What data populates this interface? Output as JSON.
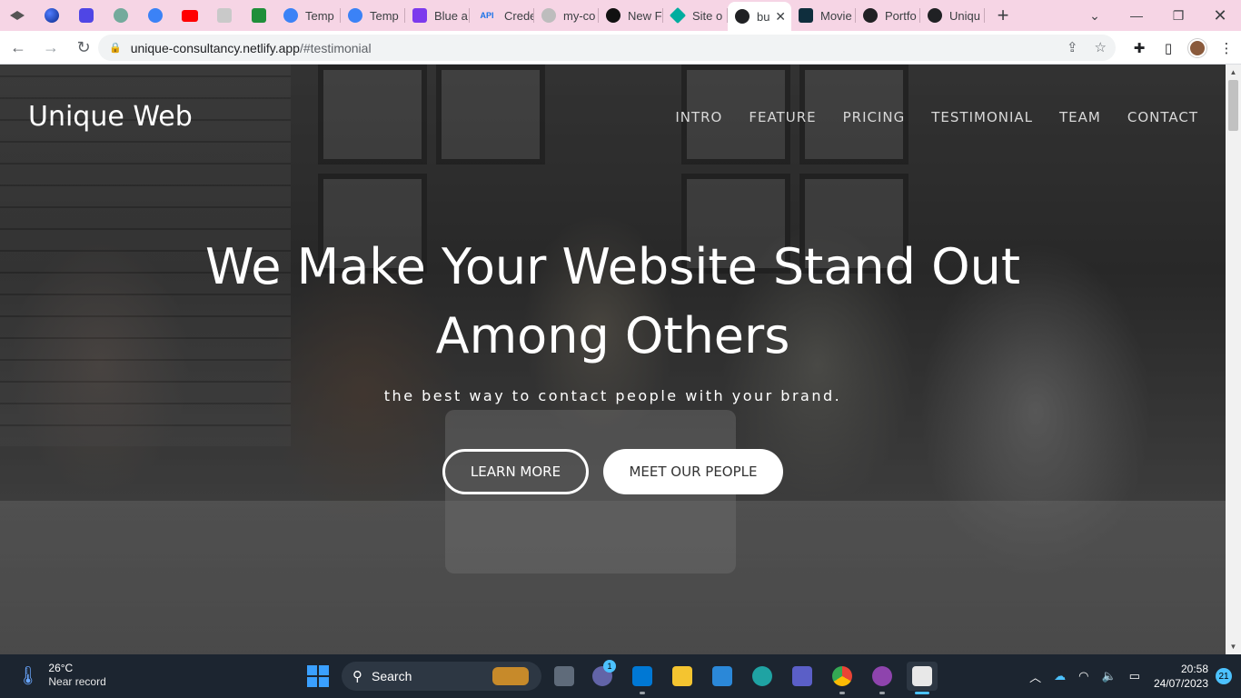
{
  "browser": {
    "tabs": [
      {
        "title": "Temp",
        "color": "#3b82f6",
        "icon": "edge-style-icon"
      },
      {
        "title": "Temp",
        "color": "#3b82f6",
        "icon": "edge-style-icon"
      },
      {
        "title": "Blue a",
        "color": "#7c3aed",
        "icon": "heart-shield-icon"
      },
      {
        "title": "Crede",
        "color": "#1a73e8",
        "icon": "api-icon"
      },
      {
        "title": "my-co",
        "color": "#bdbdbd",
        "icon": "github-icon"
      },
      {
        "title": "New F",
        "color": "#111111",
        "icon": "triangle-icon"
      },
      {
        "title": "Site o",
        "color": "#00ad9f",
        "icon": "netlify-icon"
      },
      {
        "title": "bu",
        "color": "#202124",
        "icon": "globe-icon",
        "active": true
      },
      {
        "title": "Movie",
        "color": "#0f2e3d",
        "icon": "react-icon"
      },
      {
        "title": "Portfo",
        "color": "#202124",
        "icon": "globe-icon"
      },
      {
        "title": "Uniqu",
        "color": "#202124",
        "icon": "globe-icon"
      }
    ],
    "address": {
      "host": "unique-consultancy.netlify.app",
      "path": "/#testimonial"
    },
    "api_label": "API"
  },
  "page": {
    "brand": "Unique Web",
    "nav": [
      "INTRO",
      "FEATURE",
      "PRICING",
      "TESTIMONIAL",
      "TEAM",
      "CONTACT"
    ],
    "headline_line1": "We Make Your Website Stand Out",
    "headline_line2": "Among Others",
    "tagline": "the best way to contact people with your brand.",
    "btn_primary": "LEARN MORE",
    "btn_secondary": "MEET OUR PEOPLE"
  },
  "taskbar": {
    "weather_temp": "26°C",
    "weather_desc": "Near record",
    "search_label": "Search",
    "teams_badge": "1",
    "time": "20:58",
    "date": "24/07/2023",
    "notifications": "21"
  }
}
